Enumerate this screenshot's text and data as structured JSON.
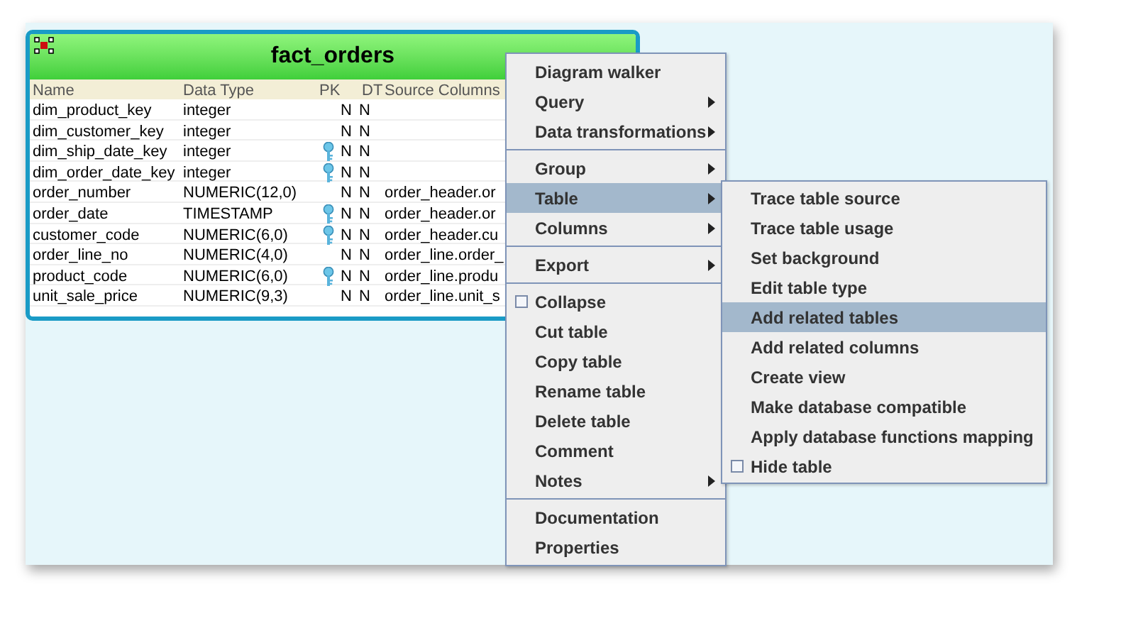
{
  "table_node": {
    "title": "fact_orders",
    "columns": [
      "Name",
      "Data Type",
      "PK",
      "DT",
      "Source Columns"
    ],
    "rows": [
      {
        "name": "dim_product_key",
        "type": "integer",
        "key": false,
        "pk": "N",
        "dt": "N",
        "source": ""
      },
      {
        "name": "dim_customer_key",
        "type": "integer",
        "key": false,
        "pk": "N",
        "dt": "N",
        "source": ""
      },
      {
        "name": "dim_ship_date_key",
        "type": "integer",
        "key": true,
        "pk": "N",
        "dt": "N",
        "source": ""
      },
      {
        "name": "dim_order_date_key",
        "type": "integer",
        "key": true,
        "pk": "N",
        "dt": "N",
        "source": ""
      },
      {
        "name": "order_number",
        "type": "NUMERIC(12,0)",
        "key": false,
        "pk": "N",
        "dt": "N",
        "source": "order_header.or"
      },
      {
        "name": "order_date",
        "type": "TIMESTAMP",
        "key": true,
        "pk": "N",
        "dt": "N",
        "source": "order_header.or"
      },
      {
        "name": "customer_code",
        "type": "NUMERIC(6,0)",
        "key": true,
        "pk": "N",
        "dt": "N",
        "source": "order_header.cu"
      },
      {
        "name": "order_line_no",
        "type": "NUMERIC(4,0)",
        "key": false,
        "pk": "N",
        "dt": "N",
        "source": "order_line.order_"
      },
      {
        "name": "product_code",
        "type": "NUMERIC(6,0)",
        "key": true,
        "pk": "N",
        "dt": "N",
        "source": "order_line.produ"
      },
      {
        "name": "unit_sale_price",
        "type": "NUMERIC(9,3)",
        "key": false,
        "pk": "N",
        "dt": "N",
        "source": "order_line.unit_s"
      }
    ]
  },
  "context_menu": {
    "sections": [
      [
        {
          "label": "Diagram walker",
          "kind": "item",
          "selected": false
        },
        {
          "label": "Query",
          "kind": "submenu",
          "selected": false
        },
        {
          "label": "Data transformations",
          "kind": "submenu",
          "selected": false
        }
      ],
      [
        {
          "label": "Group",
          "kind": "submenu",
          "selected": false
        },
        {
          "label": "Table",
          "kind": "submenu",
          "selected": true
        },
        {
          "label": "Columns",
          "kind": "submenu",
          "selected": false
        }
      ],
      [
        {
          "label": "Export",
          "kind": "submenu",
          "selected": false
        }
      ],
      [
        {
          "label": "Collapse",
          "kind": "checkbox",
          "checked": false,
          "selected": false
        },
        {
          "label": "Cut table",
          "kind": "item",
          "selected": false
        },
        {
          "label": "Copy table",
          "kind": "item",
          "selected": false
        },
        {
          "label": "Rename table",
          "kind": "item",
          "selected": false
        },
        {
          "label": "Delete table",
          "kind": "item",
          "selected": false
        },
        {
          "label": "Comment",
          "kind": "item",
          "selected": false
        },
        {
          "label": "Notes",
          "kind": "submenu",
          "selected": false
        }
      ],
      [
        {
          "label": "Documentation",
          "kind": "item",
          "selected": false
        },
        {
          "label": "Properties",
          "kind": "item",
          "selected": false
        }
      ]
    ]
  },
  "table_submenu": {
    "items": [
      {
        "label": "Trace table source",
        "kind": "item",
        "selected": false
      },
      {
        "label": "Trace table usage",
        "kind": "item",
        "selected": false
      },
      {
        "label": "Set background",
        "kind": "item",
        "selected": false
      },
      {
        "label": "Edit table type",
        "kind": "item",
        "selected": false
      },
      {
        "label": "Add related tables",
        "kind": "item",
        "selected": true
      },
      {
        "label": "Add related columns",
        "kind": "item",
        "selected": false
      },
      {
        "label": "Create view",
        "kind": "item",
        "selected": false
      },
      {
        "label": "Make database compatible",
        "kind": "item",
        "selected": false
      },
      {
        "label": "Apply database functions mapping",
        "kind": "item",
        "selected": false
      },
      {
        "label": "Hide table",
        "kind": "checkbox",
        "checked": false,
        "selected": false
      }
    ]
  }
}
